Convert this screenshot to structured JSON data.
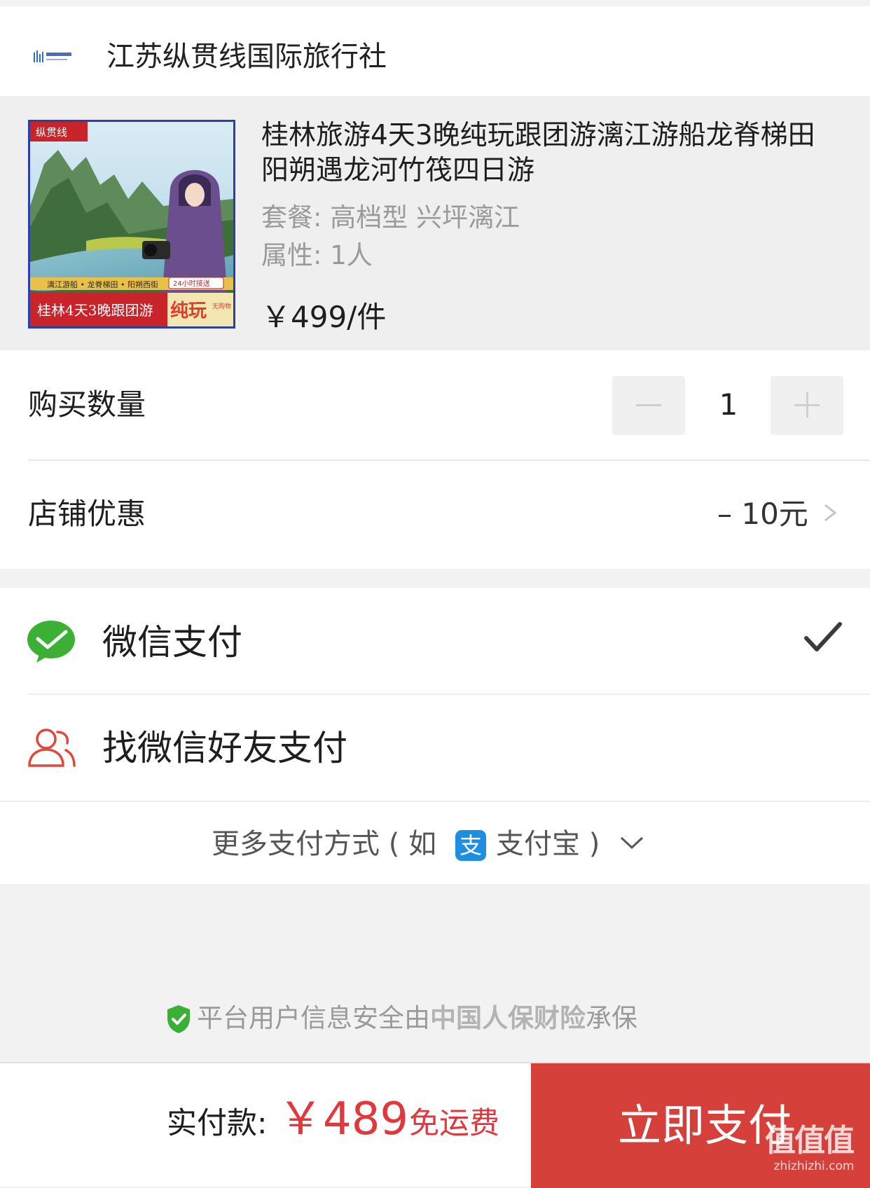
{
  "store": {
    "name": "江苏纵贯线国际旅行社"
  },
  "product": {
    "title": "桂林旅游4天3晚纯玩跟团游漓江游船龙脊梯田阳朔遇龙河竹筏四日游",
    "spec": "套餐: 高档型 兴坪漓江",
    "attr": "属性: 1人",
    "price": "￥499/件",
    "image": {
      "brand": "纵贯线",
      "tags": "漓江游船 • 龙脊梯田 • 阳朔西街",
      "badge": "24小时接送",
      "caption": "桂林4天3晚跟团游",
      "highlight": "纯玩",
      "note": "无购物"
    }
  },
  "quantity": {
    "label": "购买数量",
    "value": "1"
  },
  "coupon": {
    "label": "店铺优惠",
    "value": "– 10元"
  },
  "payment": {
    "wechat_label": "微信支付",
    "wechat_selected": true,
    "friend_label": "找微信好友支付",
    "more_prefix": "更多支付方式 ( 如",
    "alipay_glyph": "支",
    "more_suffix": "支付宝 )"
  },
  "insurance": {
    "prefix": "平台用户信息安全由",
    "insurer": "中国人保财险",
    "suffix": "承保"
  },
  "footer": {
    "total_label": "实付款:",
    "total_value": "￥489",
    "shipping": "免运费",
    "pay_button": "立即支付"
  },
  "watermark": {
    "main": "值值值",
    "sub": "zhizhizhi.com"
  },
  "colors": {
    "accent": "#d6403a",
    "price_red": "#e0383d",
    "wechat_green": "#3cb034",
    "alipay_blue": "#1e8fe0"
  }
}
